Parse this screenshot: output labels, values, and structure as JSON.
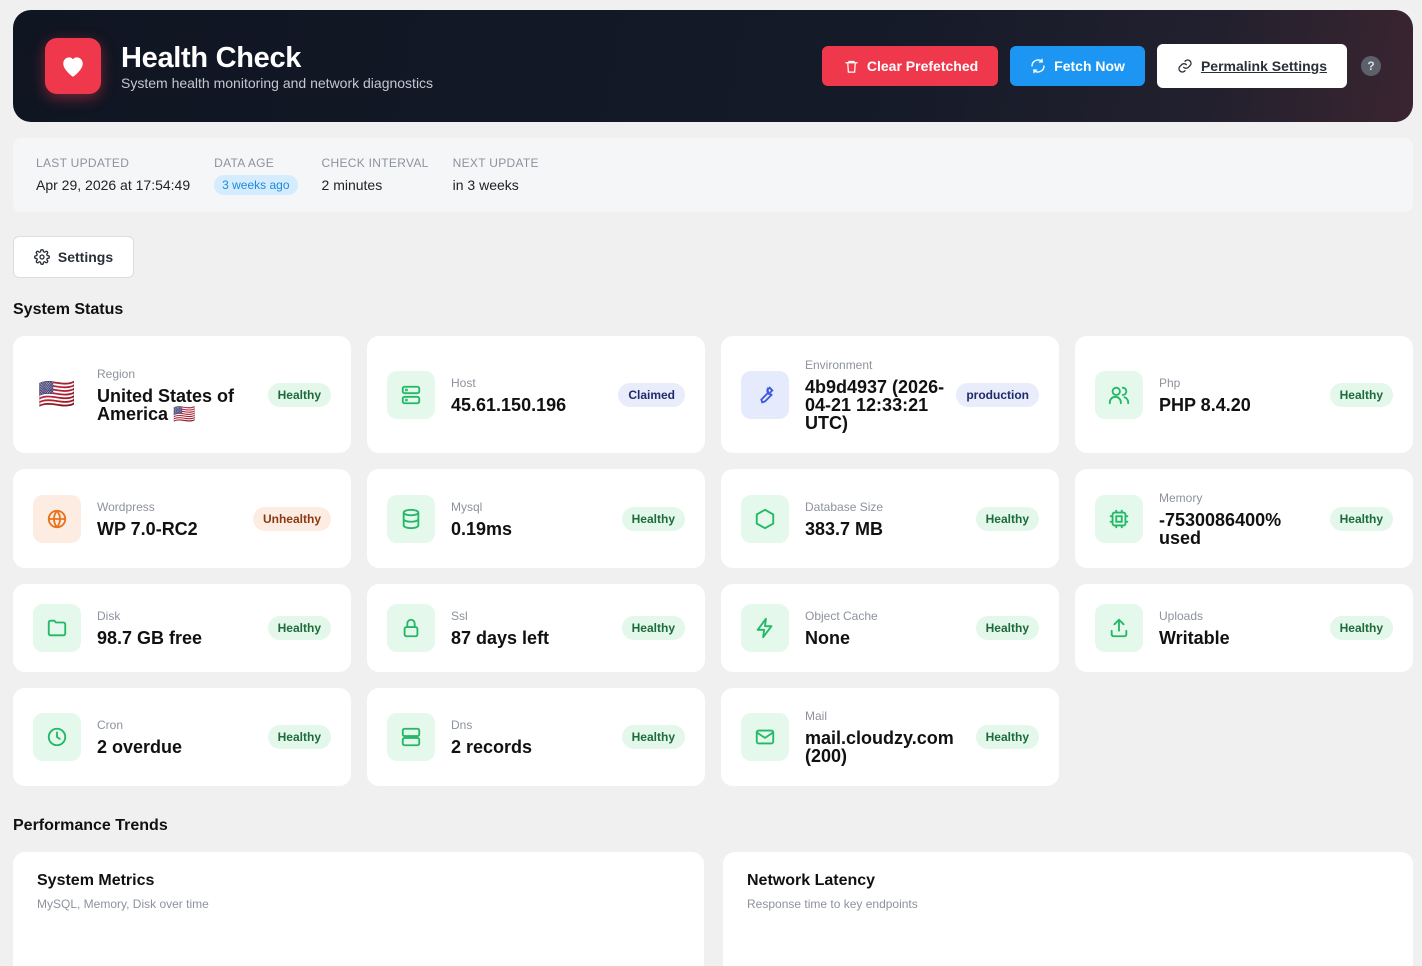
{
  "header": {
    "title": "Health Check",
    "subtitle": "System health monitoring and network diagnostics",
    "clear_label": "Clear Prefetched",
    "fetch_label": "Fetch Now",
    "permalink_label": "Permalink Settings",
    "help_label": "?"
  },
  "info": {
    "last_updated_label": "LAST UPDATED",
    "last_updated_value": "Apr 29, 2026 at 17:54:49",
    "data_age_label": "DATA AGE",
    "data_age_value": "3 weeks ago",
    "interval_label": "CHECK INTERVAL",
    "interval_value": "2 minutes",
    "next_label": "NEXT UPDATE",
    "next_value": "in 3 weeks"
  },
  "settings_label": "Settings",
  "system_status_title": "System Status",
  "cards": [
    {
      "label": "Region",
      "value": "United States of America 🇺🇸",
      "badge": "Healthy",
      "icon": "🇺🇸"
    },
    {
      "label": "Host",
      "value": "45.61.150.196",
      "badge": "Claimed",
      "icon": "server-icon"
    },
    {
      "label": "Environment",
      "value": "4b9d4937 (2026-04-21 12:33:21 UTC)",
      "badge": "production",
      "icon": "wrench-icon"
    },
    {
      "label": "Php",
      "value": "PHP 8.4.20",
      "badge": "Healthy",
      "icon": "users-icon"
    },
    {
      "label": "Wordpress",
      "value": "WP 7.0-RC2",
      "badge": "Unhealthy",
      "icon": "globe-icon"
    },
    {
      "label": "Mysql",
      "value": "0.19ms",
      "badge": "Healthy",
      "icon": "database-icon"
    },
    {
      "label": "Database Size",
      "value": "383.7 MB",
      "badge": "Healthy",
      "icon": "hexagon-icon"
    },
    {
      "label": "Memory",
      "value": "-7530086400% used",
      "badge": "Healthy",
      "icon": "cpu-icon"
    },
    {
      "label": "Disk",
      "value": "98.7 GB free",
      "badge": "Healthy",
      "icon": "folder-icon"
    },
    {
      "label": "Ssl",
      "value": "87 days left",
      "badge": "Healthy",
      "icon": "lock-icon"
    },
    {
      "label": "Object Cache",
      "value": "None",
      "badge": "Healthy",
      "icon": "bolt-icon"
    },
    {
      "label": "Uploads",
      "value": "Writable",
      "badge": "Healthy",
      "icon": "upload-icon"
    },
    {
      "label": "Cron",
      "value": "2 overdue",
      "badge": "Healthy",
      "icon": "clock-icon"
    },
    {
      "label": "Dns",
      "value": "2 records",
      "badge": "Healthy",
      "icon": "dns-icon"
    },
    {
      "label": "Mail",
      "value": "mail.cloudzy.com (200)",
      "badge": "Healthy",
      "icon": "mail-icon"
    }
  ],
  "performance_title": "Performance Trends",
  "panels": [
    {
      "title": "System Metrics",
      "subtitle": "MySQL, Memory, Disk over time"
    },
    {
      "title": "Network Latency",
      "subtitle": "Response time to key endpoints"
    }
  ],
  "colors": {
    "accent_red": "#f0384c",
    "accent_blue": "#1c96f2",
    "healthy_green": "#22b866",
    "unhealthy_orange": "#e8731f",
    "info_blue": "#3b5bdb"
  }
}
